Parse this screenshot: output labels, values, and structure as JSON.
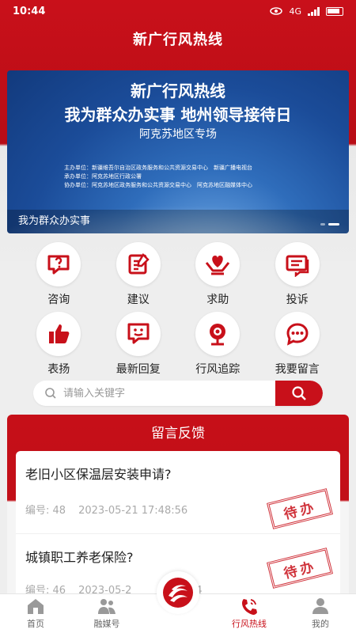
{
  "status": {
    "time": "10:44",
    "network": "4G"
  },
  "app": {
    "title": "新广行风热线"
  },
  "banner": {
    "line1": "新广行风热线",
    "line2": "我为群众办实事 地州领导接待日",
    "line3": "阿克苏地区专场",
    "orgs": [
      "主办单位：新疆维吾尔自治区政务服务和公共资源交易中心　新疆广播电视台",
      "承办单位：阿克苏地区行政公署",
      "协办单位：阿克苏地区政务服务和公共资源交易中心　阿克苏地区融媒体中心"
    ],
    "caption": "我为群众办实事"
  },
  "grid": [
    {
      "label": "咨询",
      "icon": "consult-icon"
    },
    {
      "label": "建议",
      "icon": "suggestion-icon"
    },
    {
      "label": "求助",
      "icon": "help-icon"
    },
    {
      "label": "投诉",
      "icon": "complaint-icon"
    },
    {
      "label": "表扬",
      "icon": "praise-icon"
    },
    {
      "label": "最新回复",
      "icon": "latest-reply-icon"
    },
    {
      "label": "行风追踪",
      "icon": "tracking-icon"
    },
    {
      "label": "我要留言",
      "icon": "leave-message-icon"
    }
  ],
  "search": {
    "placeholder": "请输入关键字"
  },
  "feedback": {
    "title": "留言反馈",
    "items": [
      {
        "title": "老旧小区保温层安装申请?",
        "id_label": "编号: 48",
        "time": "2023-05-21 17:48:56",
        "status": "待办"
      },
      {
        "title": "城镇职工养老保险?",
        "id_label": "编号: 46",
        "time": "2023-05-2",
        "time_tail": "5:24",
        "status": "待办"
      }
    ]
  },
  "nav": [
    {
      "label": "首页",
      "icon": "home-icon"
    },
    {
      "label": "融媒号",
      "icon": "media-icon"
    },
    {
      "label": "",
      "icon": "logo-icon"
    },
    {
      "label": "行风热线",
      "icon": "hotline-phone-icon"
    },
    {
      "label": "我的",
      "icon": "profile-icon"
    }
  ],
  "colors": {
    "brand": "#c8101a",
    "banner_blue": "#1b4c99"
  }
}
